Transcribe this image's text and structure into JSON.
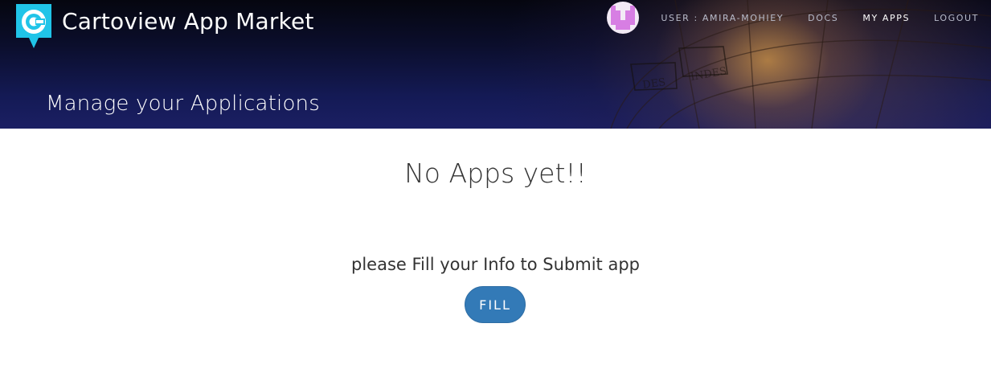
{
  "header": {
    "brand_title": "Cartoview App Market",
    "logo_icon": "cartoview-logo-icon",
    "nav": {
      "user_label": "USER : AMIRA-MOHIEY",
      "docs_label": "DOCS",
      "my_apps_label": "MY APPS",
      "logout_label": "LOGOUT"
    },
    "page_heading": "Manage your Applications"
  },
  "main": {
    "empty_title": "No Apps yet!!",
    "prompt": "please Fill your Info to Submit app",
    "fill_button_label": "FILL"
  },
  "colors": {
    "brand_accent": "#20c4e8",
    "primary_button": "#337ab7",
    "hero_dark": "#0b0e2c",
    "avatar_pink": "#d77ee3"
  }
}
